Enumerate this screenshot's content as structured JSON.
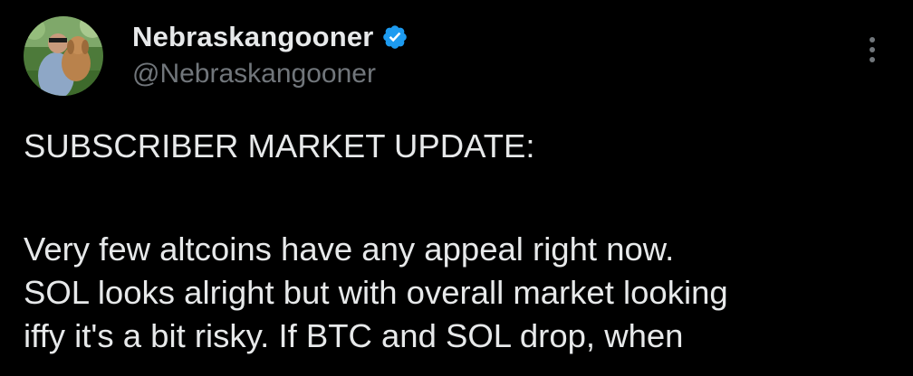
{
  "author": {
    "display_name": "Nebraskangooner",
    "handle": "@Nebraskangooner",
    "verified_icon": "verified-badge-icon",
    "verified_color": "#1d9bf0"
  },
  "menu": {
    "more_icon": "more-vertical-icon"
  },
  "post": {
    "line_1": "SUBSCRIBER MARKET UPDATE:",
    "line_2": "Very few altcoins have any appeal right now.",
    "line_3": "SOL looks alright but with overall market looking",
    "line_4": "iffy it's a bit risky. If BTC and SOL drop, when"
  },
  "colors": {
    "background": "#000000",
    "text_primary": "#e7e9ea",
    "text_secondary": "#71767b"
  }
}
